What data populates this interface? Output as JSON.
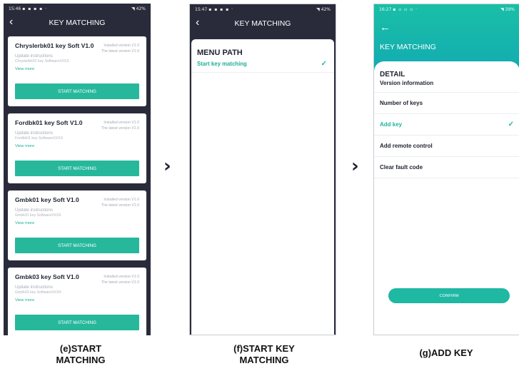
{
  "screen_e": {
    "status": {
      "time": "15:46",
      "right": "42%"
    },
    "title": "KEY MATCHING",
    "cards": [
      {
        "name": "Chryslerbk01 key Soft V1.0",
        "installed": "Installed version V1.0",
        "latest": "The latest version V1.0",
        "update": "Update instructions",
        "software": "Chryslerbk01 key SoftwareXXXX",
        "more": "View more",
        "button": "START MATCHING"
      },
      {
        "name": "Fordbk01 key Soft V1.0",
        "installed": "Installed version V1.0",
        "latest": "The latest version V1.0",
        "update": "Update instructions",
        "software": "Fordbk01 key SoftwareXXXX",
        "more": "View more",
        "button": "START MATCHING"
      },
      {
        "name": "Gmbk01 key Soft V1.0",
        "installed": "Installed version V1.0",
        "latest": "The latest version V1.0",
        "update": "Update instructions",
        "software": "Gmbk01 key SoftwareXXXX",
        "more": "View more",
        "button": "START MATCHING"
      },
      {
        "name": "Gmbk03 key Soft V1.0",
        "installed": "Installed version V1.0",
        "latest": "The latest version V1.0",
        "update": "Update instructions",
        "software": "Gmbk03 key SoftwareXXXX",
        "more": "View more",
        "button": "START MATCHING"
      }
    ]
  },
  "screen_f": {
    "status": {
      "time": "15:47",
      "right": "42%"
    },
    "title": "KEY MATCHING",
    "heading": "MENU PATH",
    "item": "Start key matching"
  },
  "screen_g": {
    "status": {
      "time": "16:27",
      "right": "39%"
    },
    "title": "KEY MATCHING",
    "heading": "DETAIL",
    "items": [
      "Version information",
      "Number of keys",
      "Add key",
      "Add remote control",
      "Clear fault code"
    ],
    "active_index": 2,
    "confirm": "CONFIRM"
  },
  "captions": {
    "e": "(e)START MATCHING",
    "f": "(f)START KEY MATCHING",
    "g": "(g)ADD KEY"
  },
  "icons": {
    "back": "back-arrow-icon",
    "check": "checkmark-icon",
    "next": "chevron-right-icon"
  },
  "colors": {
    "accent": "#27b89c",
    "dark_bg": "#2a2b3a",
    "header_gradient_start": "#1abfa6",
    "header_gradient_end": "#11a8b4"
  }
}
